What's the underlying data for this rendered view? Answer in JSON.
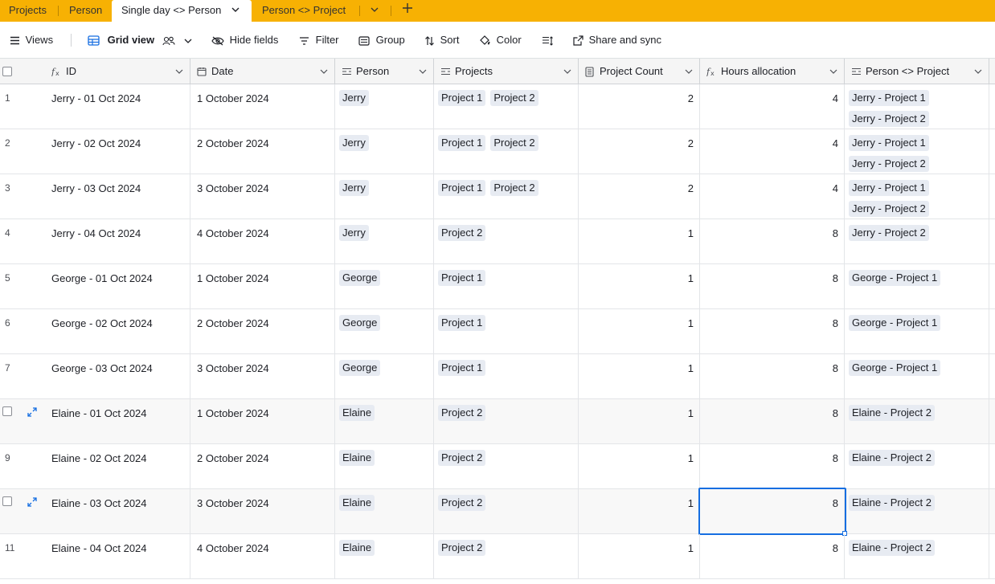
{
  "tabs": [
    {
      "label": "Projects"
    },
    {
      "label": "Person"
    },
    {
      "label": "Single day <> Person"
    },
    {
      "label": "Person <> Project"
    }
  ],
  "toolbar": {
    "views": "Views",
    "grid_view": "Grid view",
    "hide_fields": "Hide fields",
    "filter": "Filter",
    "group": "Group",
    "sort": "Sort",
    "color": "Color",
    "share": "Share and sync"
  },
  "columns": [
    {
      "label": "ID",
      "icon": "formula-icon"
    },
    {
      "label": "Date",
      "icon": "calendar-icon"
    },
    {
      "label": "Person",
      "icon": "link-icon"
    },
    {
      "label": "Projects",
      "icon": "link-icon"
    },
    {
      "label": "Project Count",
      "icon": "count-icon"
    },
    {
      "label": "Hours allocation",
      "icon": "formula-icon"
    },
    {
      "label": "Person <> Project",
      "icon": "link-icon"
    }
  ],
  "rows": [
    {
      "num": "1",
      "id": "Jerry - 01 Oct 2024",
      "date": "1 October 2024",
      "person": "Jerry",
      "projects": [
        "Project 1",
        "Project 2"
      ],
      "count": "2",
      "hours": "4",
      "pp": [
        "Jerry - Project 1",
        "Jerry - Project 2"
      ]
    },
    {
      "num": "2",
      "id": "Jerry - 02 Oct 2024",
      "date": "2 October 2024",
      "person": "Jerry",
      "projects": [
        "Project 1",
        "Project 2"
      ],
      "count": "2",
      "hours": "4",
      "pp": [
        "Jerry - Project 1",
        "Jerry - Project 2"
      ]
    },
    {
      "num": "3",
      "id": "Jerry - 03 Oct 2024",
      "date": "3 October 2024",
      "person": "Jerry",
      "projects": [
        "Project 1",
        "Project 2"
      ],
      "count": "2",
      "hours": "4",
      "pp": [
        "Jerry - Project 1",
        "Jerry - Project 2"
      ]
    },
    {
      "num": "4",
      "id": "Jerry - 04 Oct 2024",
      "date": "4 October 2024",
      "person": "Jerry",
      "projects": [
        "Project 2"
      ],
      "count": "1",
      "hours": "8",
      "pp": [
        "Jerry - Project 2"
      ]
    },
    {
      "num": "5",
      "id": "George - 01 Oct 2024",
      "date": "1 October 2024",
      "person": "George",
      "projects": [
        "Project 1"
      ],
      "count": "1",
      "hours": "8",
      "pp": [
        "George - Project 1"
      ]
    },
    {
      "num": "6",
      "id": "George - 02 Oct 2024",
      "date": "2 October 2024",
      "person": "George",
      "projects": [
        "Project 1"
      ],
      "count": "1",
      "hours": "8",
      "pp": [
        "George - Project 1"
      ]
    },
    {
      "num": "7",
      "id": "George - 03 Oct 2024",
      "date": "3 October 2024",
      "person": "George",
      "projects": [
        "Project 1"
      ],
      "count": "1",
      "hours": "8",
      "pp": [
        "George - Project 1"
      ]
    },
    {
      "num": "",
      "id": "Elaine - 01 Oct 2024",
      "date": "1 October 2024",
      "person": "Elaine",
      "projects": [
        "Project 2"
      ],
      "count": "1",
      "hours": "8",
      "pp": [
        "Elaine - Project 2"
      ],
      "hover": true
    },
    {
      "num": "9",
      "id": "Elaine - 02 Oct 2024",
      "date": "2 October 2024",
      "person": "Elaine",
      "projects": [
        "Project 2"
      ],
      "count": "1",
      "hours": "8",
      "pp": [
        "Elaine - Project 2"
      ]
    },
    {
      "num": "",
      "id": "Elaine - 03 Oct 2024",
      "date": "3 October 2024",
      "person": "Elaine",
      "projects": [
        "Project 2"
      ],
      "count": "1",
      "hours": "8",
      "pp": [
        "Elaine - Project 2"
      ],
      "hover": true,
      "selected": true
    },
    {
      "num": "11",
      "id": "Elaine - 04 Oct 2024",
      "date": "4 October 2024",
      "person": "Elaine",
      "projects": [
        "Project 2"
      ],
      "count": "1",
      "hours": "8",
      "pp": [
        "Elaine - Project 2"
      ]
    }
  ],
  "colors": {
    "tabbar": "#f7b103",
    "selection": "#166ee1",
    "pill": "#e7ebf2"
  }
}
